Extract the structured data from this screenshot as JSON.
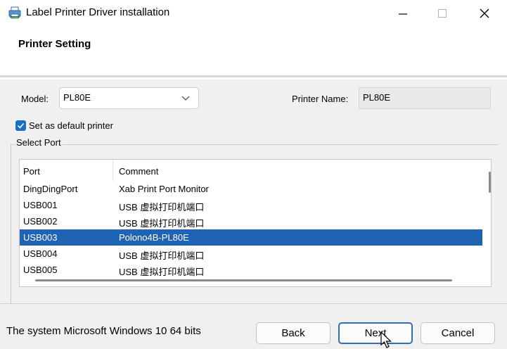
{
  "window": {
    "title": "Label Printer Driver installation",
    "icons": {
      "app": "printer-icon",
      "minimize": "minimize-icon",
      "maximize": "maximize-icon",
      "close": "close-icon"
    }
  },
  "header": {
    "title": "Printer Setting"
  },
  "form": {
    "model_label": "Model:",
    "model_value": "PL80E",
    "printer_name_label": "Printer Name:",
    "printer_name_value": "PL80E",
    "default_checkbox_label": "Set as default printer",
    "default_checked": true
  },
  "port_group": {
    "label": "Select Port",
    "columns": [
      "Port",
      "Comment"
    ],
    "rows": [
      {
        "port": "DingDingPort",
        "comment": "Xab Print Port Monitor",
        "selected": false
      },
      {
        "port": "USB001",
        "comment": "USB 虚拟打印机端口",
        "selected": false
      },
      {
        "port": "USB002",
        "comment": "USB 虚拟打印机端口",
        "selected": false
      },
      {
        "port": "USB003",
        "comment": "Polono4B-PL80E",
        "selected": true
      },
      {
        "port": "USB004",
        "comment": "USB 虚拟打印机端口",
        "selected": false
      },
      {
        "port": "USB005",
        "comment": "USB 虚拟打印机端口",
        "selected": false
      }
    ]
  },
  "footer": {
    "system_text": "The system Microsoft Windows 10 64 bits",
    "back_label": "Back",
    "next_label": "Next",
    "cancel_label": "Cancel"
  },
  "colors": {
    "accent": "#1f63b4",
    "checkbox": "#1a6fc8",
    "next_border": "#2f6db5"
  }
}
